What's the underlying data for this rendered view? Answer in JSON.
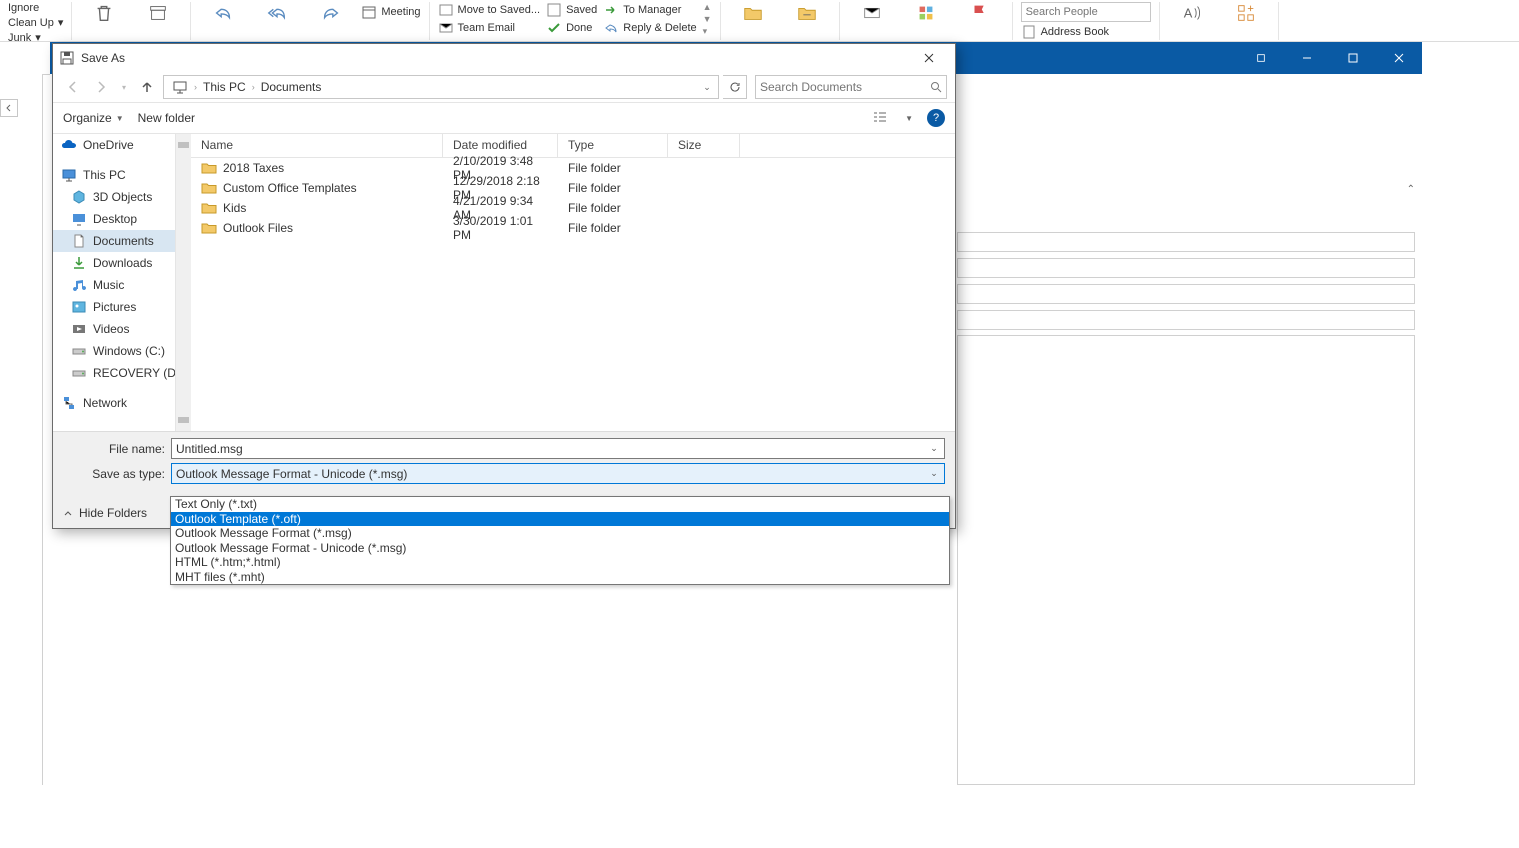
{
  "ribbon": {
    "ignore": "Ignore",
    "clean_up": "Clean Up",
    "junk": "Junk",
    "meeting": "Meeting",
    "move_to_saved": "Move to Saved...",
    "team_email": "Team Email",
    "saved": "Saved",
    "done": "Done",
    "to_manager": "To Manager",
    "reply_delete": "Reply & Delete",
    "search_people_placeholder": "Search People",
    "address_book": "Address Book"
  },
  "dialog_title": "Save As",
  "breadcrumb": {
    "root": "This PC",
    "folder": "Documents"
  },
  "search_placeholder": "Search Documents",
  "toolbar": {
    "organize": "Organize",
    "new_folder": "New folder"
  },
  "columns": {
    "name": "Name",
    "date": "Date modified",
    "type": "Type",
    "size": "Size"
  },
  "nav": {
    "onedrive": "OneDrive",
    "this_pc": "This PC",
    "objects3d": "3D Objects",
    "desktop": "Desktop",
    "documents": "Documents",
    "downloads": "Downloads",
    "music": "Music",
    "pictures": "Pictures",
    "videos": "Videos",
    "windows_c": "Windows (C:)",
    "recovery_d": "RECOVERY (D:)",
    "network": "Network"
  },
  "files": [
    {
      "name": "2018 Taxes",
      "date": "2/10/2019 3:48 PM",
      "type": "File folder"
    },
    {
      "name": "Custom Office Templates",
      "date": "12/29/2018 2:18 PM",
      "type": "File folder"
    },
    {
      "name": "Kids",
      "date": "4/21/2019 9:34 AM",
      "type": "File folder"
    },
    {
      "name": "Outlook Files",
      "date": "3/30/2019 1:01 PM",
      "type": "File folder"
    }
  ],
  "labels": {
    "file_name": "File name:",
    "save_as_type": "Save as type:",
    "hide_folders": "Hide Folders"
  },
  "file_name_value": "Untitled.msg",
  "save_type_value": "Outlook Message Format - Unicode (*.msg)",
  "type_options": [
    "Text Only (*.txt)",
    "Outlook Template (*.oft)",
    "Outlook Message Format (*.msg)",
    "Outlook Message Format - Unicode (*.msg)",
    "HTML (*.htm;*.html)",
    "MHT files (*.mht)"
  ],
  "type_selected_index": 1
}
